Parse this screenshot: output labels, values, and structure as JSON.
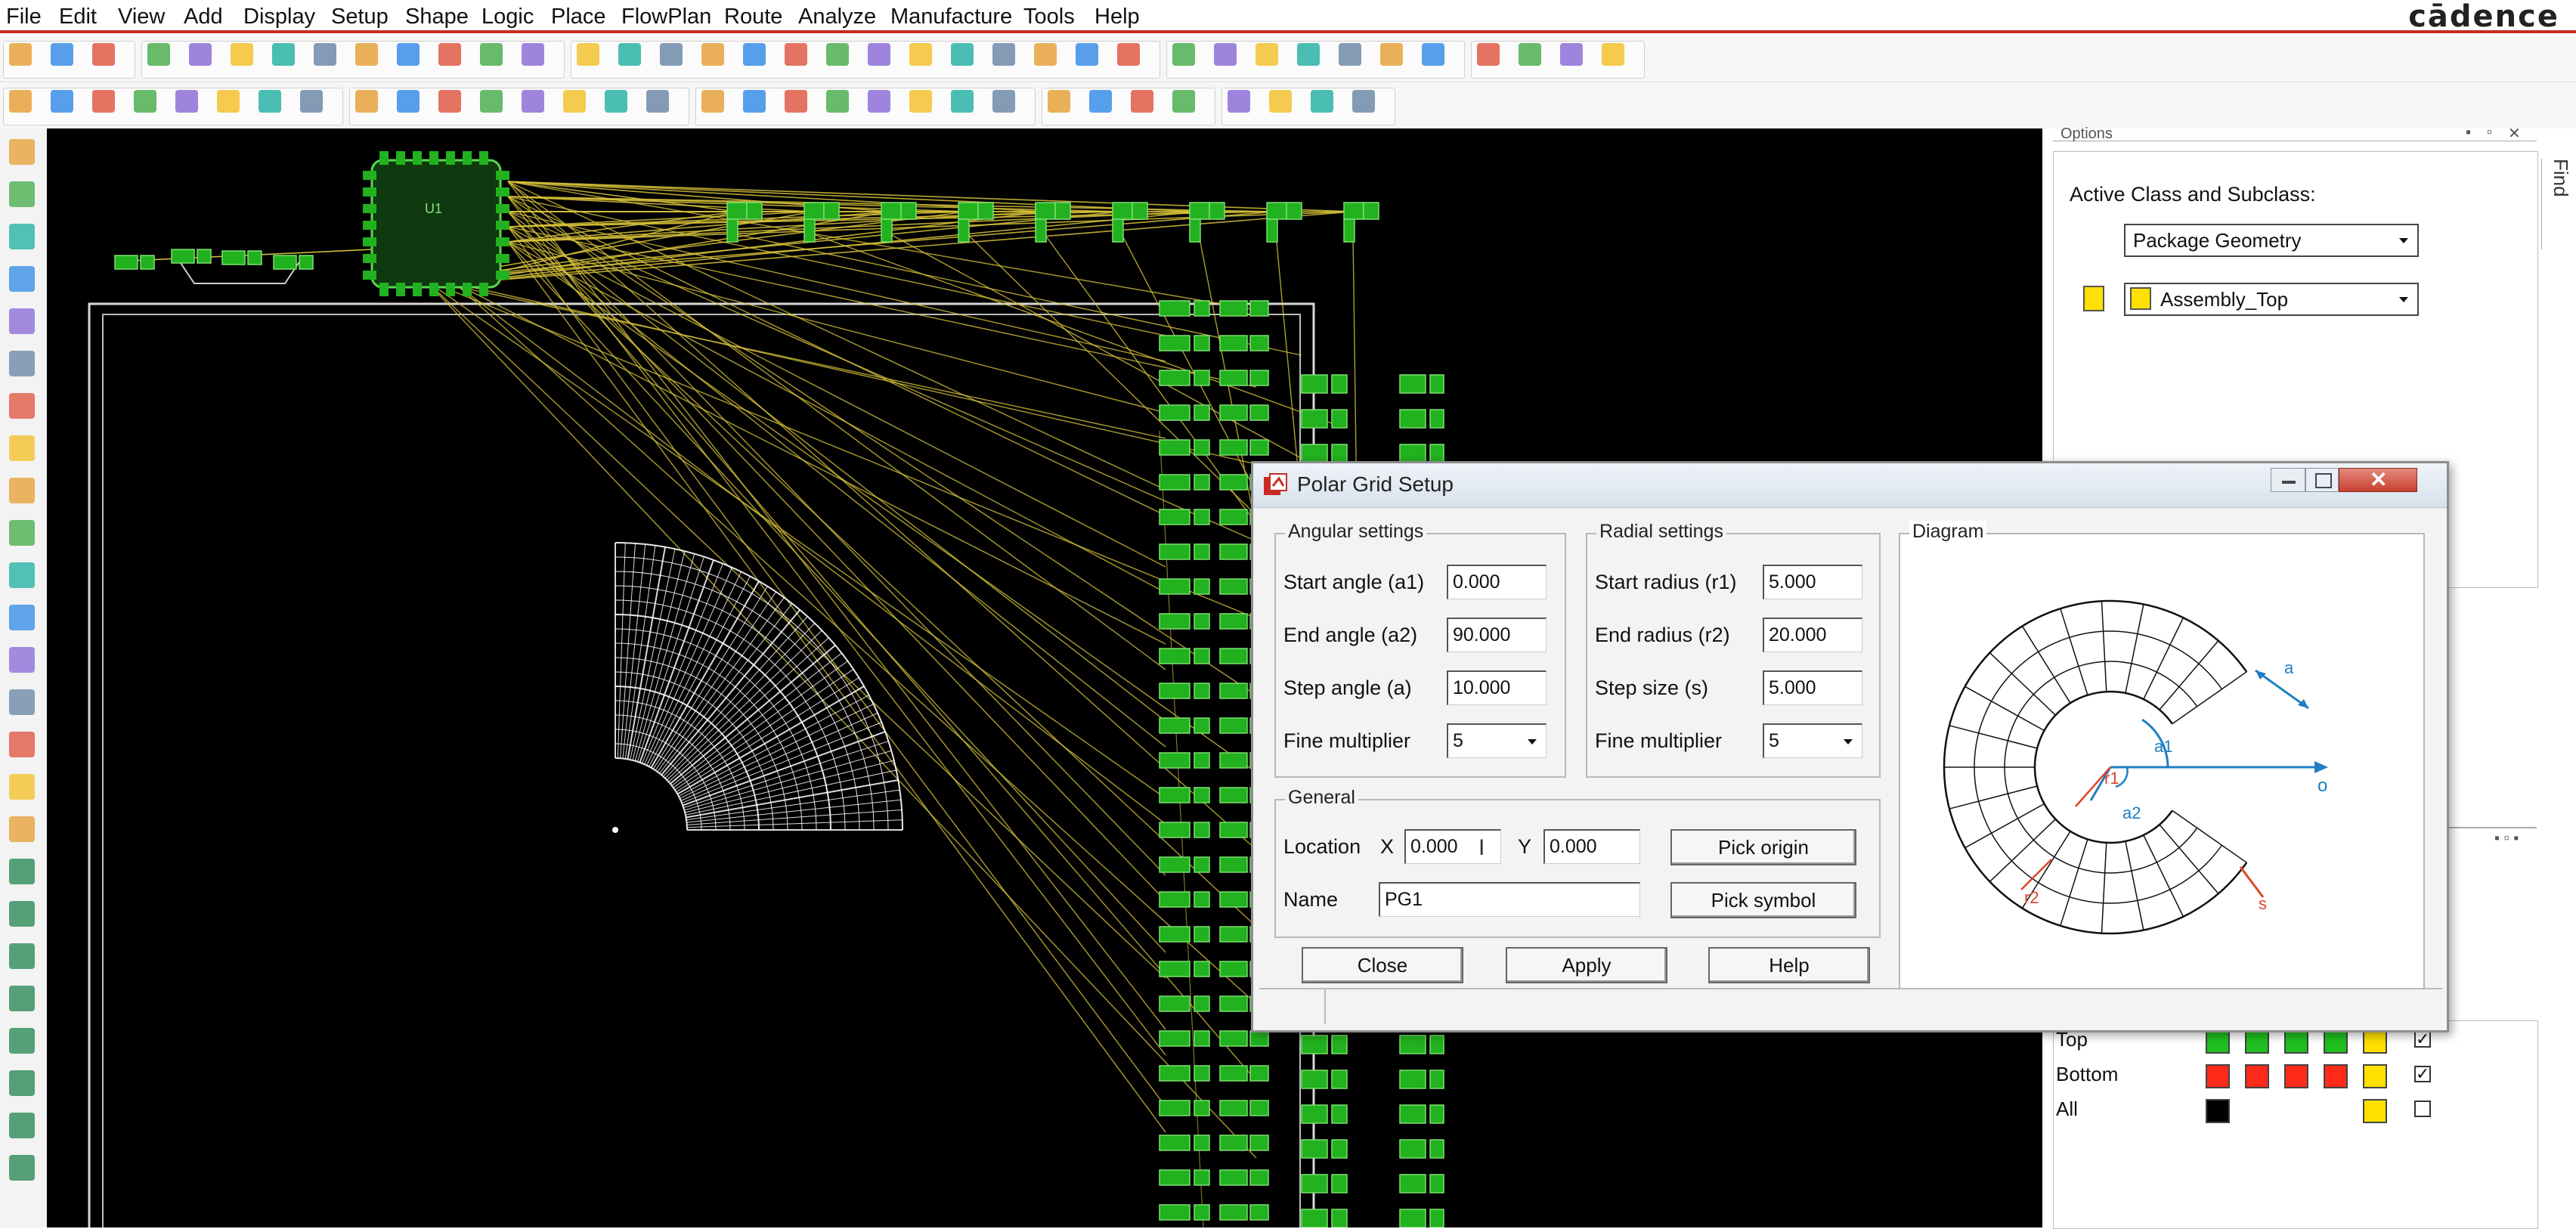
{
  "menu": [
    "File",
    "Edit",
    "View",
    "Add",
    "Display",
    "Setup",
    "Shape",
    "Logic",
    "Place",
    "FlowPlan",
    "Route",
    "Analyze",
    "Manufacture",
    "Tools",
    "Help"
  ],
  "brand": "cādence",
  "options_panel": {
    "title": "Options",
    "active_label": "Active Class and Subclass:",
    "class_value": "Package Geometry",
    "subclass_value": "Assembly_Top",
    "subclass_color": "#ffe000",
    "find_tab": "Find"
  },
  "layer_table": [
    {
      "name": "Top",
      "colors": [
        "#1fbf1f",
        "#1fbf1f",
        "#1fbf1f",
        "#1fbf1f",
        "#ffe000"
      ],
      "checked": "✓"
    },
    {
      "name": "Bottom",
      "colors": [
        "#ff2a1a",
        "#ff2a1a",
        "#ff2a1a",
        "#ff2a1a",
        "#ffe000"
      ],
      "checked": "✓"
    },
    {
      "name": "All",
      "colors": [
        "#000000",
        "",
        "",
        "",
        "#ffe000"
      ],
      "checked": ""
    }
  ],
  "dialog": {
    "title": "Polar Grid Setup",
    "angular": {
      "label": "Angular settings",
      "start_label": "Start angle (a1)",
      "start_value": "0.000",
      "end_label": "End angle (a2)",
      "end_value": "90.000",
      "step_label": "Step angle (a)",
      "step_value": "10.000",
      "fine_label": "Fine multiplier",
      "fine_value": "5"
    },
    "radial": {
      "label": "Radial settings",
      "start_label": "Start radius (r1)",
      "start_value": "5.000",
      "end_label": "End radius (r2)",
      "end_value": "20.000",
      "step_label": "Step size (s)",
      "step_value": "5.000",
      "fine_label": "Fine multiplier",
      "fine_value": "5"
    },
    "general": {
      "label": "General",
      "location_label": "Location",
      "x_label": "X",
      "x_value": "0.000",
      "y_label": "Y",
      "y_value": "0.000",
      "name_label": "Name",
      "name_value": "PG1",
      "pick_origin": "Pick origin",
      "pick_symbol": "Pick symbol"
    },
    "diagram": {
      "label": "Diagram",
      "a": "a",
      "a1": "a1",
      "a2": "a2",
      "r1": "r1",
      "r2": "r2",
      "s": "s",
      "origin": "o"
    },
    "buttons": {
      "close": "Close",
      "apply": "Apply",
      "help": "Help"
    }
  },
  "colors": {
    "accent_red": "#c82b23",
    "board_green": "#22b11f",
    "rat_yellow": "#d9c43a",
    "canvas_bg": "#000000",
    "diagram_blue": "#1f7fc0",
    "diagram_red": "#e0452a"
  },
  "icons": {
    "toolbar1": [
      "new-file-icon",
      "open-file-icon",
      "save-icon",
      "move-icon",
      "copy-icon",
      "delete-icon",
      "undo-icon",
      "redo-icon",
      "undo-history-icon",
      "redo-history-icon",
      "pin-icon",
      "push-pin-icon",
      "zoom-fit-icon",
      "zoom-world-icon",
      "zoom-in-icon",
      "zoom-out-icon",
      "zoom-prev-icon",
      "zoom-points-icon",
      "zoom-selection-icon",
      "shadow-mode-icon",
      "3d-view-icon",
      "layers-icon",
      "grid-icon",
      "color-icon",
      "visibility-icon",
      "drc-icon",
      "palette-icon",
      "settings-icon",
      "snap-icon",
      "info-icon",
      "property-icon",
      "measure-icon",
      "brush-icon",
      "sun-icon",
      "light-icon",
      "stats-icon",
      "timer-icon",
      "report-icon"
    ],
    "toolbar2": [
      "layer-top-icon",
      "layer-bottom-icon",
      "assembly-icon",
      "silk-icon",
      "mask-icon",
      "paste-icon",
      "view-icon",
      "copper-icon",
      "route-icon",
      "via-icon",
      "pin-swap-icon",
      "shape-icon",
      "rect-icon",
      "circle-icon",
      "poly-icon",
      "void-icon",
      "merge-icon",
      "slice-icon",
      "text-icon",
      "dimension-icon",
      "lock-icon",
      "interactive-route-icon",
      "fanout-icon",
      "tune-icon",
      "group-icon",
      "bundle-icon",
      "flow-icon",
      "refresh-icon",
      "analysis-icon",
      "constraint-icon",
      "swap-icon",
      "help-icon"
    ],
    "left": [
      "place-icon",
      "component-icon",
      "net-icon",
      "route-icon",
      "pin-icon",
      "signal-icon",
      "spread-icon",
      "bundle-icon",
      "constraint-icon",
      "target-icon",
      "link-icon",
      "line-icon",
      "rect-icon",
      "shape-add-icon",
      "brush-icon",
      "connect-icon",
      "cline-icon",
      "slide-icon",
      "delay-tune-icon",
      "diff-pair-icon",
      "gloss-icon",
      "via-icon",
      "stub-icon",
      "fanout-icon",
      "group-route-icon"
    ]
  }
}
